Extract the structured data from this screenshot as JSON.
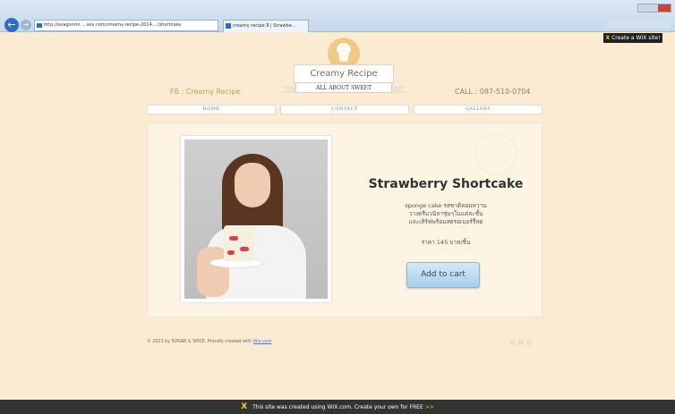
{
  "browser": {
    "address": "http://exagonmi.....wix.com/creamy-recipe-2014..../shortcake",
    "tab_title": "creamy recipe ลี  | Strawbe..."
  },
  "wix_badge": {
    "label": "Create a WIX site!"
  },
  "site": {
    "brand": "Creamy Recipe",
    "tagline": "ALL ABOUT SWEET",
    "facebook": "FB : Creamy Recipe",
    "call": "CALL : 087-510-0704"
  },
  "nav": [
    {
      "label": "HOME"
    },
    {
      "label": "CONTACT"
    },
    {
      "label": "GALLERY"
    }
  ],
  "product": {
    "title": "Strawberry Shortcake",
    "description_lines": [
      "sponge cake รสชาติหอมหวาน",
      "วางครีมวนิลาชุ่มๆในแต่ละชั้น",
      "และเสิร์ฟพร้อมสตรอเบอร์รี่สด"
    ],
    "price": "ราคา 145 บาท/ชิ้น",
    "cart_label": "Add to cart"
  },
  "footer": {
    "credit": "© 2023 by SUGAR & SPICE. Proudly created with",
    "credit_link": "Wix.com"
  },
  "bottom_bar": {
    "text": "This site was created using WIX.com. Create your own for FREE",
    "arrows": ">>"
  },
  "colors": {
    "page_bg": "#fcebd3",
    "accent_gold": "#f0c987",
    "wix_yellow": "#f6d21c",
    "button_blue": "#a9cfe8"
  }
}
